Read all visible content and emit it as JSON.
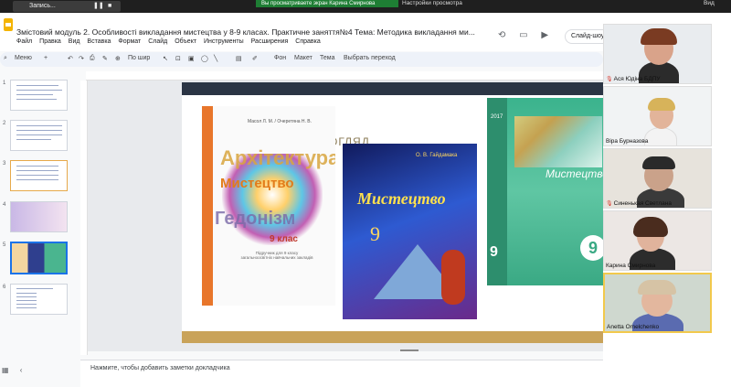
{
  "topbar": {
    "record_label": "Запись...",
    "share_banner": "Вы просматриваете экран Карина Смирнова",
    "view_settings": "Настройки просмотра",
    "right_label": "Вид"
  },
  "header": {
    "title": "Змістовий модуль 2. Особливості викладання мистецтва у 8-9 класах. Практичне заняття№4 Тема: Методика викладання ми...",
    "menu": [
      "Файл",
      "Правка",
      "Вид",
      "Вставка",
      "Формат",
      "Слайд",
      "Объект",
      "Инструменты",
      "Расширения",
      "Справка"
    ],
    "present_label": "Слайд-шоу"
  },
  "toolbar": {
    "menu_label": "Меню",
    "zoom_label": "По шир",
    "bg_label": "Фон",
    "layout_label": "Макет",
    "theme_label": "Тема",
    "transition_label": "Выбрать переход"
  },
  "filmstrip": {
    "slides": [
      {
        "num": "1"
      },
      {
        "num": "2"
      },
      {
        "num": "3"
      },
      {
        "num": "4"
      },
      {
        "num": "5"
      },
      {
        "num": "6"
      }
    ],
    "selected": 5
  },
  "slide": {
    "bg_word": "ОГЛЯД",
    "book1": {
      "authors": "Масол Л. М. / Очеретяна Н. В.",
      "arch": "Архітектура",
      "title": "Мистецтво",
      "hedonism": "Гедонізм",
      "class": "9 клас",
      "subtitle": "Підручник для 9 класу загальноосвітніх навчальних закладів"
    },
    "book2": {
      "author": "О. В. Гайдамака",
      "title": "Мистецтво",
      "num": "9"
    },
    "book3": {
      "year": "2017",
      "title": "Мистецтво",
      "num_left": "9",
      "num_right": "9"
    }
  },
  "notes": {
    "placeholder": "Нажмите, чтобы добавить заметки докладчика"
  },
  "participants": [
    {
      "name": "Ася Юдіна БДПУ",
      "muted": true
    },
    {
      "name": "Віра Бурназова",
      "muted": false
    },
    {
      "name": "Синенькая Светлана",
      "muted": true
    },
    {
      "name": "Карина Смирнова",
      "muted": false
    },
    {
      "name": "Anetta Omelchenko",
      "muted": false
    }
  ]
}
